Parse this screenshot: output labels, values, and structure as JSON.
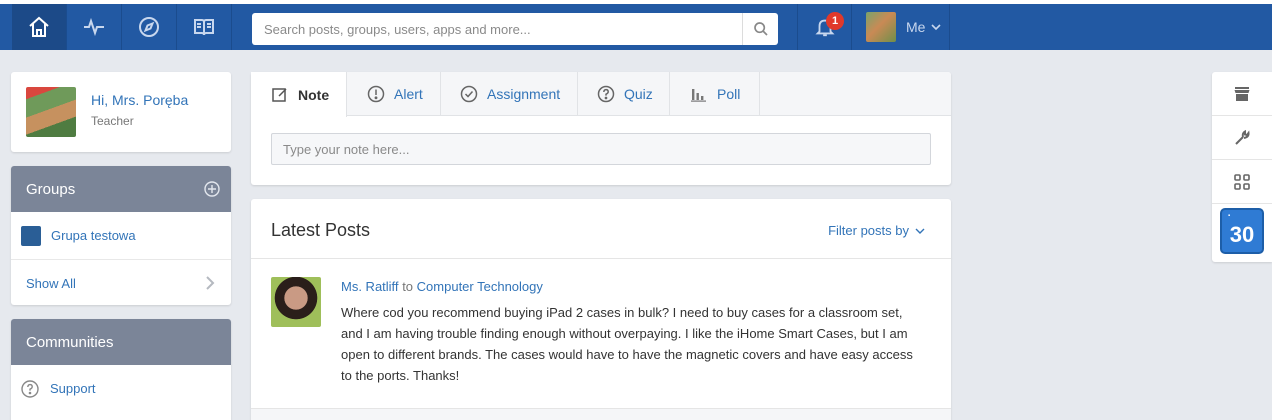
{
  "nav": {
    "home_icon": "home-icon",
    "activity_icon": "activity-icon",
    "discover_icon": "compass-icon",
    "library_icon": "book-icon",
    "search_placeholder": "Search posts, groups, users, apps and more...",
    "notification_count": "1",
    "me_label": "Me",
    "accent": "#2259a3"
  },
  "profile": {
    "greeting": "Hi, Mrs. Poręba",
    "role": "Teacher"
  },
  "groups": {
    "title": "Groups",
    "items": [
      {
        "label": "Grupa testowa",
        "color": "#2a5e96"
      }
    ],
    "show_all": "Show All"
  },
  "communities": {
    "title": "Communities",
    "items": [
      {
        "label": "Support"
      }
    ]
  },
  "composer": {
    "tabs": [
      {
        "label": "Note",
        "icon": "note-icon"
      },
      {
        "label": "Alert",
        "icon": "alert-icon"
      },
      {
        "label": "Assignment",
        "icon": "check-icon"
      },
      {
        "label": "Quiz",
        "icon": "question-icon"
      },
      {
        "label": "Poll",
        "icon": "bar-chart-icon"
      }
    ],
    "note_placeholder": "Type your note here..."
  },
  "feed": {
    "title": "Latest Posts",
    "filter_label": "Filter posts by",
    "posts": [
      {
        "author": "Ms. Ratliff",
        "connector": "to",
        "group": "Computer Technology",
        "body": "Where cod you recommend buying iPad 2 cases in bulk? I need to buy cases for a classroom set, and I am having trouble finding enough without overpaying. I like the iHome Smart Cases, but I am open to different brands. The cases would have to have the magnetic covers and have easy access to the ports. Thanks!"
      }
    ]
  },
  "rightbar": {
    "items": [
      "store-icon",
      "wrench-icon",
      "grid-icon"
    ],
    "calendar_day": "30"
  }
}
